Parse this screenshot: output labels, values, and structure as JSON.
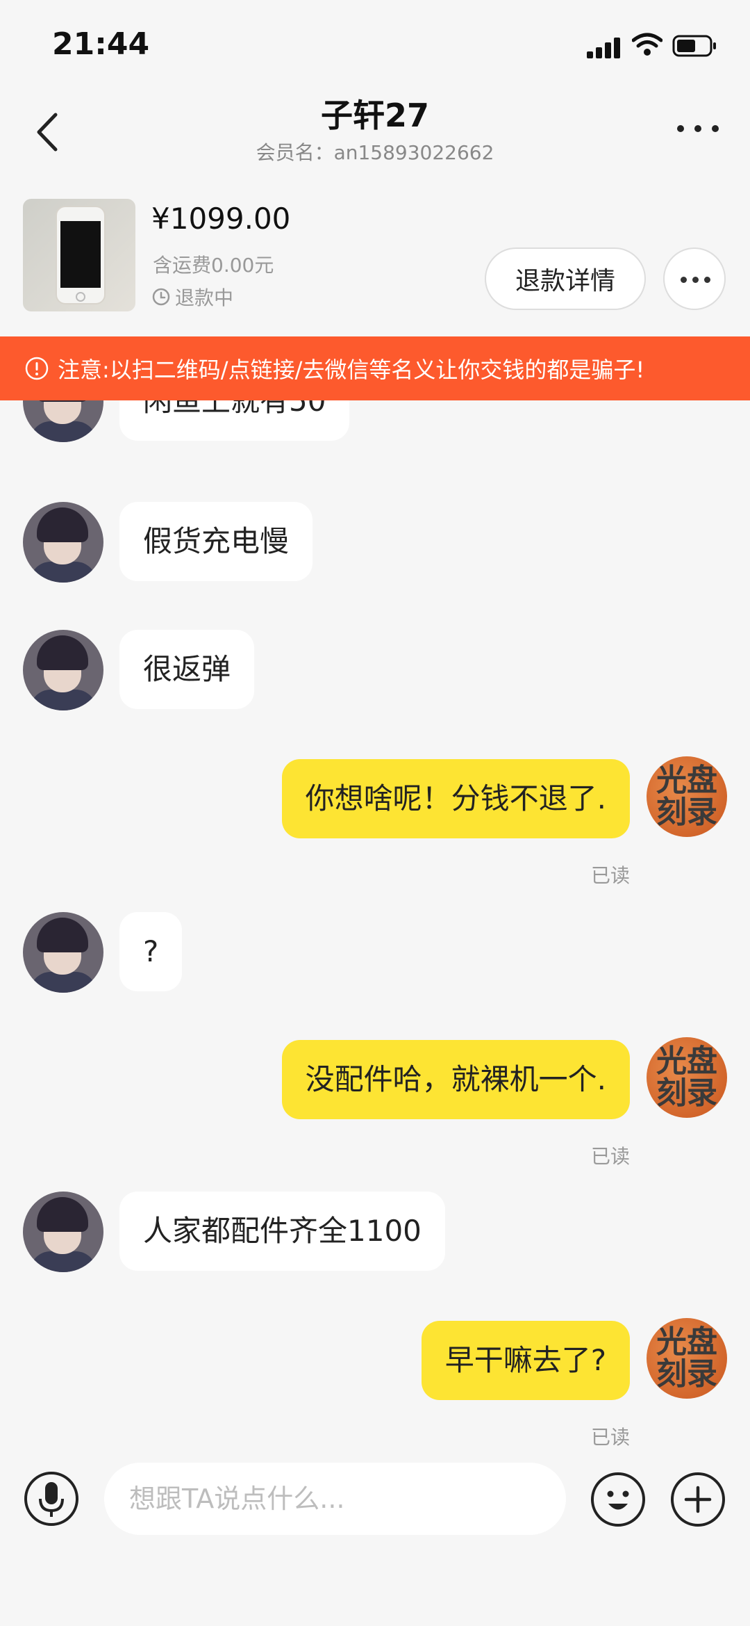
{
  "status_bar": {
    "time": "21:44"
  },
  "header": {
    "title": "子轩27",
    "subtitle": "会员名：an15893022662"
  },
  "product": {
    "price": "¥1099.00",
    "shipping": "含运费0.00元",
    "status": "退款中",
    "refund_button": "退款详情"
  },
  "warning": {
    "text": "注意:以扫二维码/点链接/去微信等名义让你交钱的都是骗子!",
    "color": "#fd5a2d"
  },
  "messages": [
    {
      "side": "left",
      "text": "闲鱼上就有50"
    },
    {
      "side": "left",
      "text": "假货充电慢"
    },
    {
      "side": "left",
      "text": "很返弹"
    },
    {
      "side": "right",
      "text": "你想啥呢！分钱不退了.",
      "status": "已读"
    },
    {
      "side": "left",
      "text": "?"
    },
    {
      "side": "right",
      "text": "没配件哈，就裸机一个.",
      "status": "已读"
    },
    {
      "side": "left",
      "text": "人家都配件齐全1100"
    },
    {
      "side": "right",
      "text": "早干嘛去了?",
      "status": "已读"
    }
  ],
  "my_avatar_text": "光盘刻录",
  "input": {
    "placeholder": "想跟TA说点什么..."
  },
  "colors": {
    "bubble_self": "#fde433",
    "bubble_other": "#ffffff",
    "background": "#f6f6f6"
  }
}
